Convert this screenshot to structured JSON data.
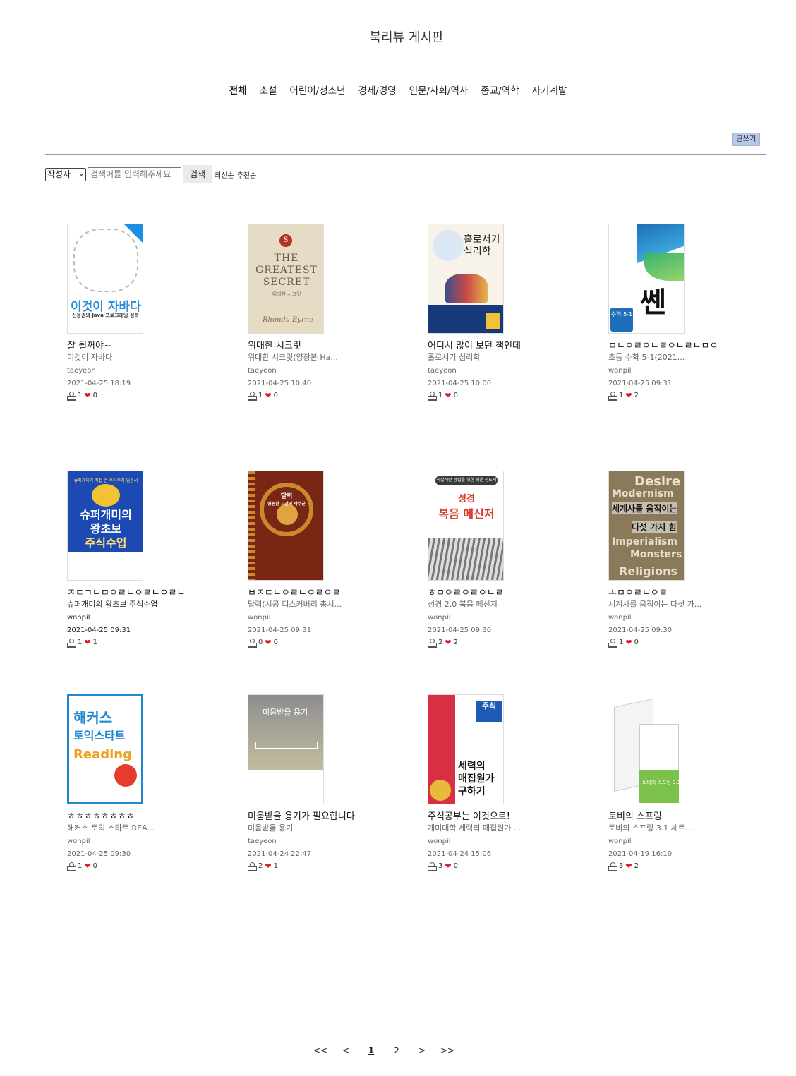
{
  "page_title": "북리뷰 게시판",
  "categories": [
    "전체",
    "소설",
    "어린이/청소년",
    "경제/경영",
    "인문/사회/역사",
    "종교/역학",
    "자기계발"
  ],
  "write_label": "글쓰기",
  "search": {
    "select_value": "작성자",
    "placeholder": "검색어를 입력해주세요",
    "button_label": "검색",
    "sort_latest": "최신순",
    "sort_recommend": "추천순"
  },
  "posts": [
    {
      "title": "잘 될꺼야~",
      "book": "이것이 자바다",
      "author": "taeyeon",
      "date": "2021-04-25 18:19",
      "views": "1",
      "likes": "0",
      "cover": {
        "line1": "이것이 자바다",
        "line2": "신용권의 Java 프로그래밍 정복"
      }
    },
    {
      "title": "위대한 시크릿",
      "book": "위대한 시크릿(양장본 Ha...",
      "author": "taeyeon",
      "date": "2021-04-25 10:40",
      "views": "1",
      "likes": "0",
      "cover": {
        "line1": "THE GREATEST SECRET",
        "line2": "위대한 시크릿",
        "line3": "Rhonda Byrne",
        "seal": "S"
      }
    },
    {
      "title": "어디서 많이 보던 책인데",
      "book": "홀로서기 심리학",
      "author": "taeyeon",
      "date": "2021-04-25 10:00",
      "views": "1",
      "likes": "0",
      "cover": {
        "line1": "홀로서기 심리학"
      }
    },
    {
      "title": "ㅁㄴㅇㄹㅇㄴㄹㅇㄴㄹㄴㅁㅇ",
      "book": "초등 수학 5-1(2021...",
      "author": "wonpil",
      "date": "2021-04-25 09:31",
      "views": "1",
      "likes": "2",
      "cover": {
        "line1": "쎈",
        "line2": "수학 5-1"
      }
    },
    {
      "title": "ㅈㄷㄱㄴㅁㅇㄹㄴㅇㄹㄴㅇㄹㄴ",
      "book": "슈퍼개미의 왕초보 주식수업",
      "author": "wonpil",
      "date": "2021-04-25 09:31",
      "views": "1",
      "likes": "1",
      "dark": true,
      "cover": {
        "line1": "슈퍼개미의",
        "line2": "왕초보",
        "line3": "주식수업",
        "top": "슈퍼개미가 직접 쓴 주식투자 입문서"
      }
    },
    {
      "title": "ㅂㅈㄷㄴㅇㄹㄴㅇㄹㅇㄹ",
      "book": "달력(시공 디스커버리 총서...",
      "author": "wonpil",
      "date": "2021-04-25 09:31",
      "views": "0",
      "likes": "0",
      "cover": {
        "line1": "달력",
        "line2": "영원한 시간의 파수꾼"
      }
    },
    {
      "title": "ㅎㅁㅇㄹㅇㄹㅇㄴㄹ",
      "book": "성경 2.0 복음 메신저",
      "author": "wonpil",
      "date": "2021-04-25 09:30",
      "views": "2",
      "likes": "2",
      "cover": {
        "line1": "성경",
        "line2": "복음 메신저",
        "top": "직설적인 방법을 위한 쉬운 전도서"
      }
    },
    {
      "title": "ㅗㅁㅇㄹㄴㅇㄹ",
      "book": "세계사를 움직이는 다섯 가...",
      "author": "wonpil",
      "date": "2021-04-25 09:30",
      "views": "1",
      "likes": "0",
      "cover": {
        "w1": "Desire",
        "w2": "Modernism",
        "k1": "세계사를 움직이는",
        "k2": "다섯 가지 힘",
        "w3": "Imperialism",
        "w4": "Monsters",
        "w5": "Religions"
      }
    },
    {
      "title": "ㅎㅎㅎㅎㅎㅎㅎㅎ",
      "book": "해커스 토익 스타트 REA...",
      "author": "wonpil",
      "date": "2021-04-25 09:30",
      "views": "1",
      "likes": "0",
      "cover": {
        "line1": "해커스",
        "line2": "토익스타트",
        "line3": "Reading"
      }
    },
    {
      "title": "미움받을 용기가 필요합니다",
      "book": "미움받을 용기",
      "author": "taeyeon",
      "date": "2021-04-24 22:47",
      "views": "2",
      "likes": "1",
      "cover": {
        "line1": "미움받을 용기"
      }
    },
    {
      "title": "주식공부는 이것으로!",
      "book": "개미대학 세력의 매집원가 ...",
      "author": "wonpil",
      "date": "2021-04-24 15:06",
      "views": "3",
      "likes": "0",
      "cover": {
        "line1": "세력의",
        "line2": "매집원가",
        "line3": "구하기",
        "tag": "주식"
      }
    },
    {
      "title": "토비의 스프링",
      "book": "토비의 스프링 3.1 세트...",
      "author": "wonpil",
      "date": "2021-04-19 16:10",
      "views": "3",
      "likes": "2",
      "cover": {
        "line1": "토비의 스프링 3.1"
      }
    }
  ],
  "pagination": [
    "<<",
    "<",
    "1",
    "2",
    ">",
    ">>"
  ],
  "pagination_current": "1",
  "colors": {
    "heart": "#d81f2a",
    "write_button": "#b8c8e8",
    "divider": "#999999"
  }
}
